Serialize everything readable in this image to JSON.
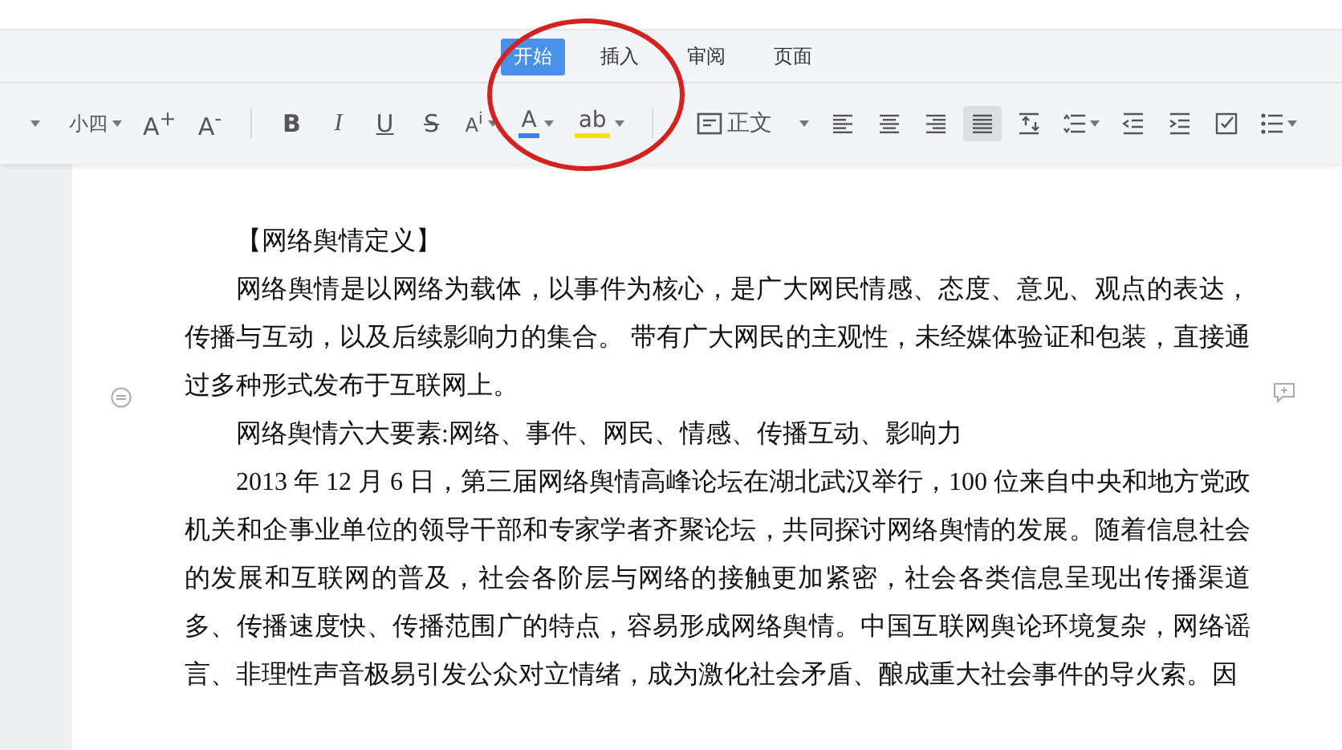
{
  "tabs": [
    {
      "label": "开始",
      "selected": true
    },
    {
      "label": "插入",
      "selected": false
    },
    {
      "label": "审阅",
      "selected": false
    },
    {
      "label": "页面",
      "selected": false
    }
  ],
  "toolbar": [
    {
      "kind": "caret"
    },
    {
      "kind": "dropdown",
      "label": "小四"
    },
    {
      "kind": "text",
      "label": "A$^{+}$"
    },
    {
      "kind": "text",
      "label": "A$^{-}$"
    },
    {
      "kind": "separator"
    },
    {
      "kind": "bold",
      "label": "B"
    },
    {
      "kind": "italic",
      "label": "I"
    },
    {
      "kind": "underline",
      "label": "U"
    },
    {
      "kind": "strike",
      "label": "S"
    },
    {
      "kind": "dropdown",
      "label": "A$^{i}$"
    },
    {
      "kind": "color",
      "label": "A",
      "color": "#3b7de9"
    },
    {
      "kind": "color",
      "label": "ab",
      "color": "#f2e600"
    },
    {
      "kind": "separator"
    },
    {
      "kind": "style",
      "label": "正文"
    },
    {
      "kind": "align-left",
      "selected": false
    },
    {
      "kind": "align-center",
      "selected": false
    },
    {
      "kind": "align-right",
      "selected": false
    },
    {
      "kind": "justify",
      "selected": true
    },
    {
      "kind": "line-spacing"
    },
    {
      "kind": "para-spacing"
    },
    {
      "kind": "outdent"
    },
    {
      "kind": "indent"
    },
    {
      "kind": "checkbox"
    },
    {
      "kind": "list"
    }
  ],
  "document": [
    {
      "kind": "heading",
      "text": "【网络舆情定义】"
    },
    {
      "kind": "body",
      "text": "网络舆情是以网络为载体，以事件为核心，是广大网民情感、态度、意见、观点的表达，传播与互动，以及后续影响力的集合。 带有广大网民的主观性，未经媒体验证和包装，直接通过多种形式发布于互联网上。"
    },
    {
      "kind": "body",
      "text": "网络舆情六大要素:网络、事件、网民、情感、传播互动、影响力"
    },
    {
      "kind": "body",
      "text": "2013 年 12 月 6 日，第三届网络舆情高峰论坛在湖北武汉举行，100 位来自中央和地方党政机关和企事业单位的领导干部和专家学者齐聚论坛，共同探讨网络舆情的发展。随着信息社会的发展和互联网的普及，社会各阶层与网络的接触更加紧密，社会各类信息呈现出传播渠道多、传播速度快、传播范围广的特点，容易形成网络舆情。中国互联网舆论环境复杂，网络谣言、非理性声音极易引发公众对立情绪，成为激化社会矛盾、酿成重大社会事件的导火索。因"
    }
  ]
}
